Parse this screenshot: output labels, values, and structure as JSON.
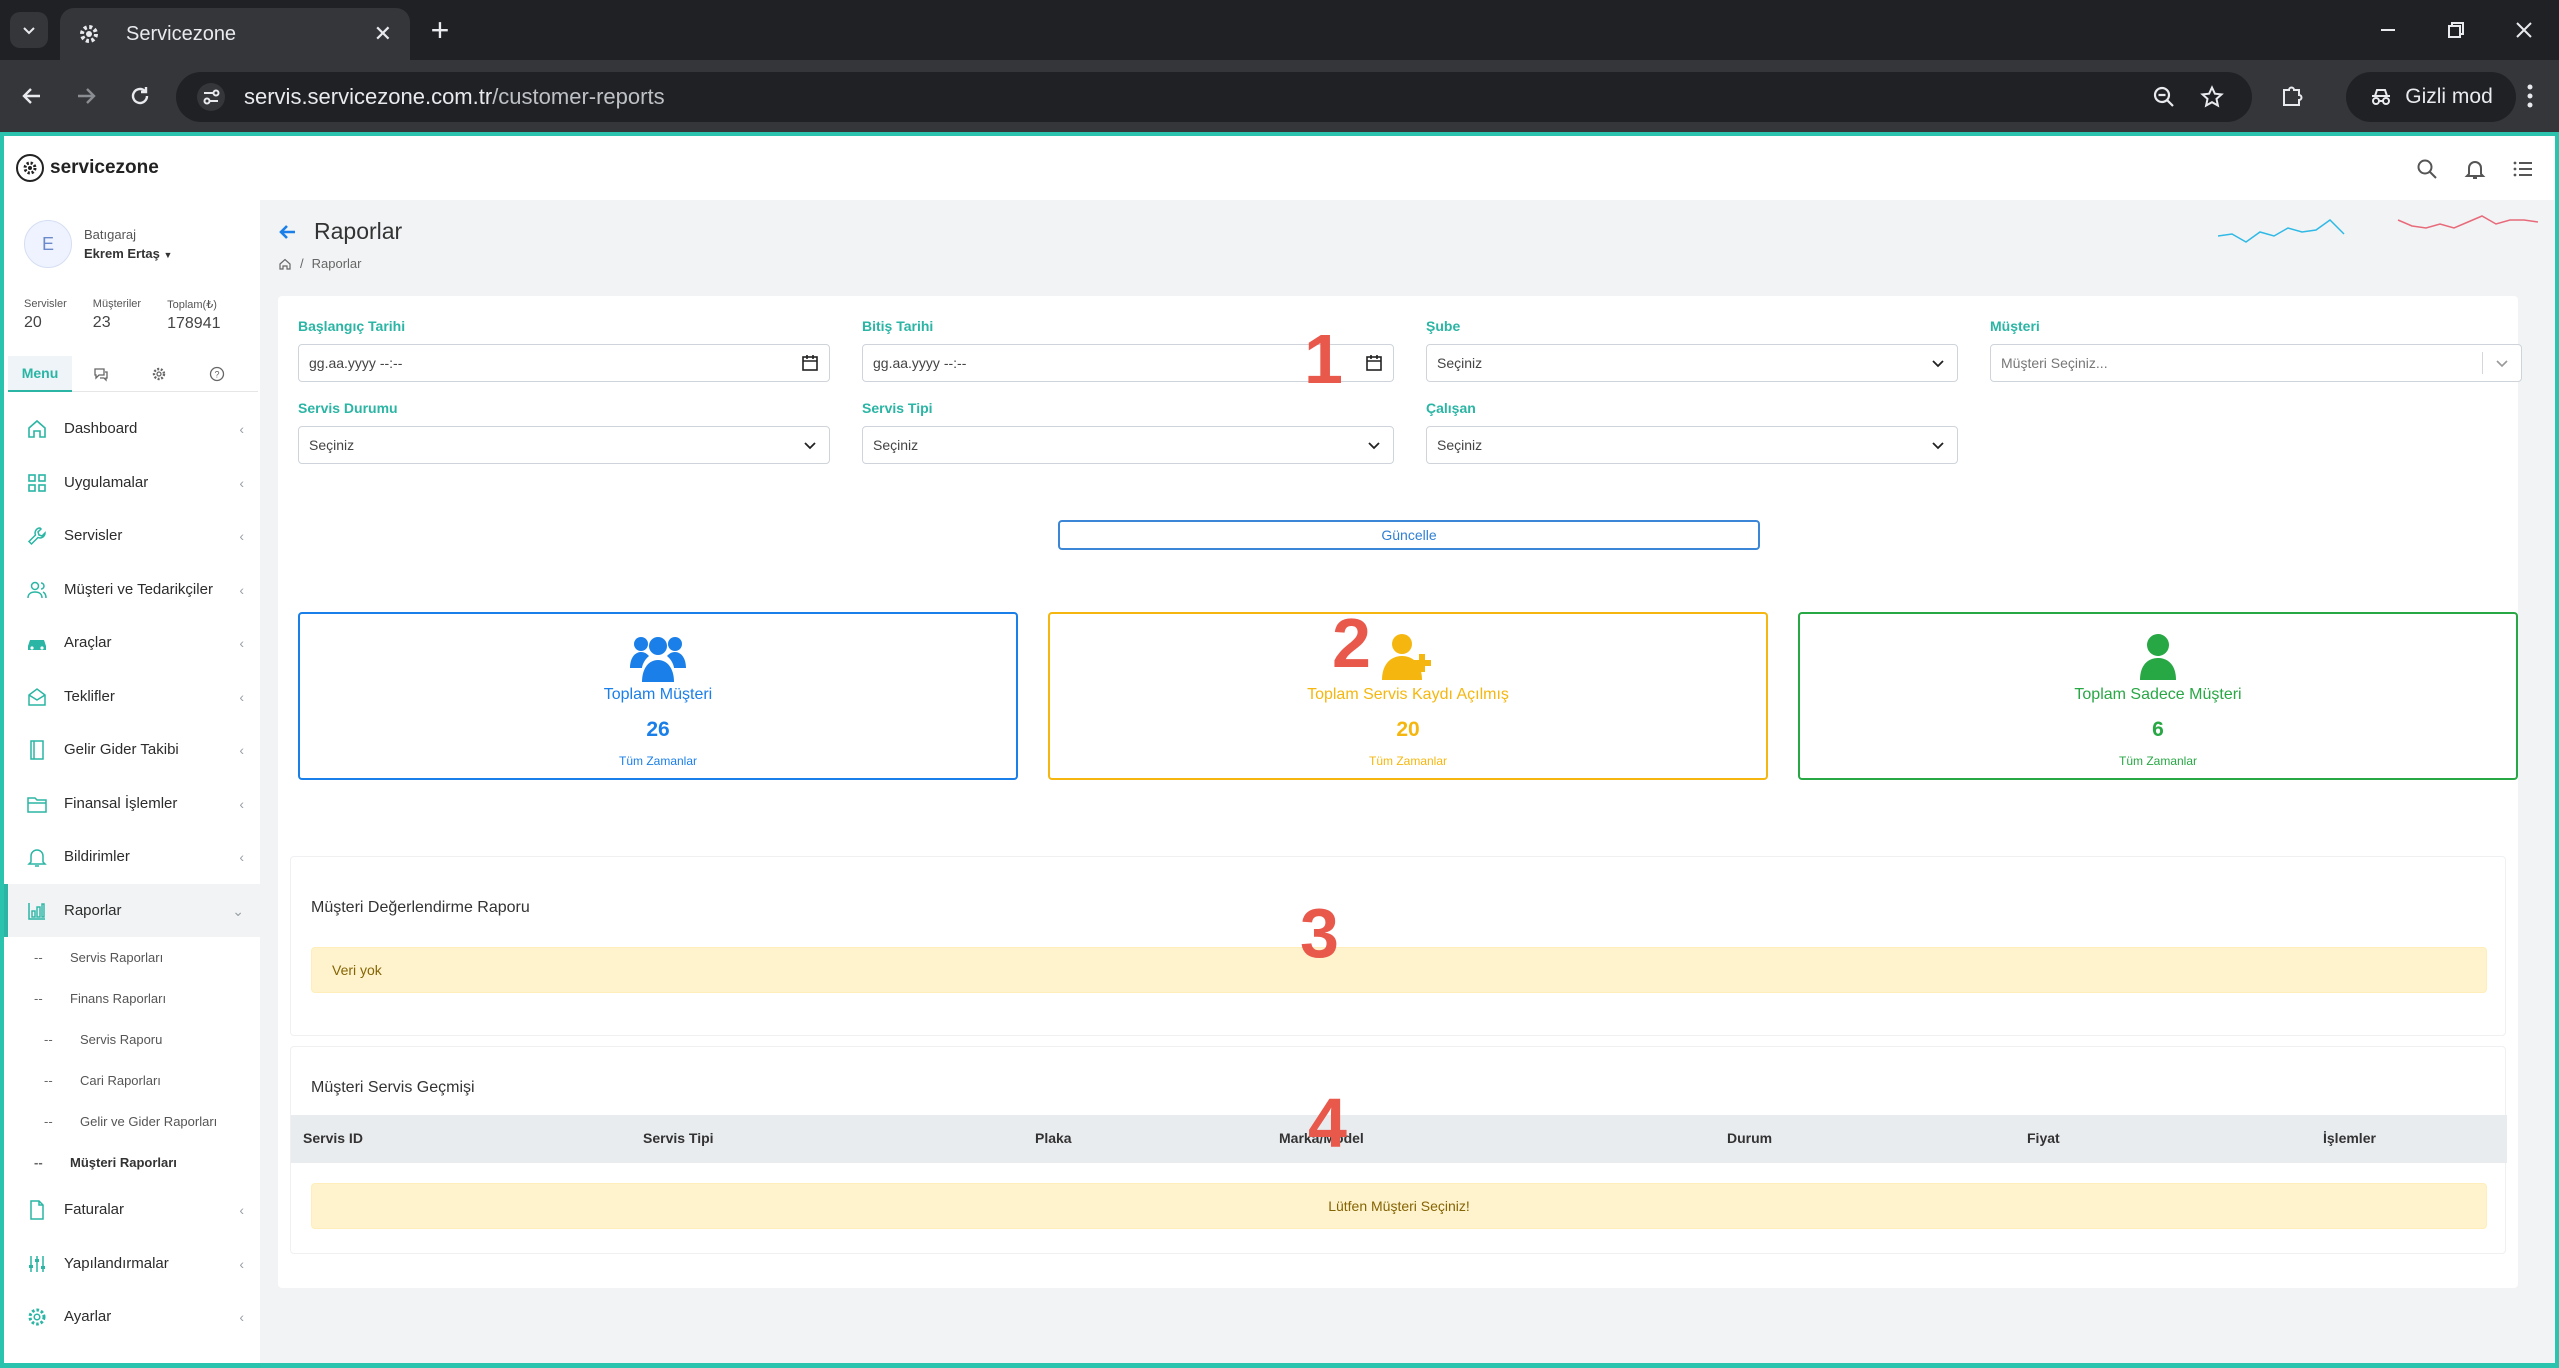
{
  "browser": {
    "tab_title": "Servicezone",
    "url_domain": "servis.servicezone.com.tr",
    "url_path": "/customer-reports",
    "incognito_label": "Gizli mod"
  },
  "header": {
    "logo_text": "servicezone"
  },
  "profile": {
    "avatar_letter": "E",
    "company": "Batıgaraj",
    "user": "Ekrem Ertaş"
  },
  "stats": [
    {
      "label": "Servisler",
      "value": "20"
    },
    {
      "label": "Müşteriler",
      "value": "23"
    },
    {
      "label": "Toplam(₺)",
      "value": "178941"
    }
  ],
  "side_tabs": {
    "menu_label": "Menu"
  },
  "menu": {
    "items": [
      {
        "label": "Dashboard",
        "icon": "home-icon"
      },
      {
        "label": "Uygulamalar",
        "icon": "grid-icon"
      },
      {
        "label": "Servisler",
        "icon": "wrench-icon"
      },
      {
        "label": "Müşteri ve Tedarikçiler",
        "icon": "users-icon"
      },
      {
        "label": "Araçlar",
        "icon": "car-icon"
      },
      {
        "label": "Teklifler",
        "icon": "envelope-icon"
      },
      {
        "label": "Gelir Gider Takibi",
        "icon": "book-icon"
      },
      {
        "label": "Finansal İşlemler",
        "icon": "folder-icon"
      },
      {
        "label": "Bildirimler",
        "icon": "bell-icon"
      },
      {
        "label": "Raporlar",
        "icon": "chart-icon"
      }
    ],
    "sub": [
      {
        "label": "Servis Raporları"
      },
      {
        "label": "Finans Raporları"
      },
      {
        "label": "Servis Raporu"
      },
      {
        "label": "Cari Raporları"
      },
      {
        "label": "Gelir ve Gider Raporları"
      },
      {
        "label": "Müşteri Raporları"
      }
    ],
    "bottom": [
      {
        "label": "Faturalar",
        "icon": "file-icon"
      },
      {
        "label": "Yapılandırmalar",
        "icon": "sliders-icon"
      },
      {
        "label": "Ayarlar",
        "icon": "gear-icon"
      }
    ]
  },
  "page": {
    "title": "Raporlar",
    "breadcrumb": "Raporlar"
  },
  "filters": {
    "start_date": {
      "label": "Başlangıç Tarihi",
      "value": "gg.aa.yyyy --:--"
    },
    "end_date": {
      "label": "Bitiş Tarihi",
      "value": "gg.aa.yyyy --:--"
    },
    "branch": {
      "label": "Şube",
      "value": "Seçiniz"
    },
    "customer": {
      "label": "Müşteri",
      "placeholder": "Müşteri Seçiniz..."
    },
    "service_status": {
      "label": "Servis Durumu",
      "value": "Seçiniz"
    },
    "service_type": {
      "label": "Servis Tipi",
      "value": "Seçiniz"
    },
    "employee": {
      "label": "Çalışan",
      "value": "Seçiniz"
    },
    "update_label": "Güncelle"
  },
  "summary_cards": [
    {
      "title": "Toplam Müşteri",
      "value": "26",
      "sub": "Tüm Zamanlar",
      "color": "#1a7fe8"
    },
    {
      "title": "Toplam Servis Kaydı Açılmış",
      "value": "20",
      "sub": "Tüm Zamanlar",
      "color": "#f5b70f"
    },
    {
      "title": "Toplam Sadece Müşteri",
      "value": "6",
      "sub": "Tüm Zamanlar",
      "color": "#28a745"
    }
  ],
  "rating_report": {
    "title": "Müşteri Değerlendirme Raporu",
    "empty": "Veri yok"
  },
  "service_history": {
    "title": "Müşteri Servis Geçmişi",
    "columns": [
      "Servis ID",
      "Servis Tipi",
      "Plaka",
      "Marka/Model",
      "Durum",
      "Fiyat",
      "İşlemler"
    ],
    "empty": "Lütfen Müşteri Seçiniz!"
  },
  "annotations": [
    "1",
    "2",
    "3",
    "4"
  ]
}
